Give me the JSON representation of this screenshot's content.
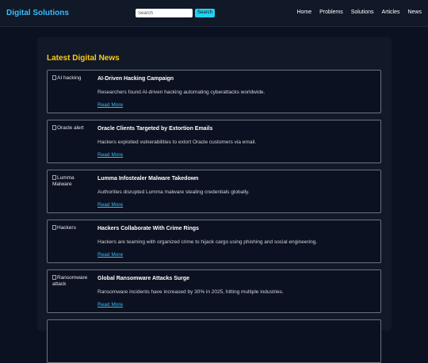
{
  "header": {
    "brand": "Digital Solutions",
    "search_placeholder": "Search",
    "search_button": "Search",
    "nav": [
      "Home",
      "Problems",
      "Solutions",
      "Articles",
      "News"
    ]
  },
  "main": {
    "title": "Latest Digital News",
    "articles": [
      {
        "img_alt": "AI hacking",
        "title": "AI-Driven Hacking Campaign",
        "summary": "Researchers found AI-driven hacking automating cyberattacks worldwide.",
        "link": "Read More"
      },
      {
        "img_alt": "Oracle alert",
        "title": "Oracle Clients Targeted by Extortion Emails",
        "summary": "Hackers exploited vulnerabilities to extort Oracle customers via email.",
        "link": "Read More"
      },
      {
        "img_alt": "Lumma Malware",
        "title": "Lumma Infostealer Malware Takedown",
        "summary": "Authorities disrupted Lumma malware stealing credentials globally.",
        "link": "Read More"
      },
      {
        "img_alt": "Hackers",
        "title": "Hackers Collaborate With Crime Rings",
        "summary": "Hackers are teaming with organized crime to hijack cargo using phishing and social engineering.",
        "link": "Read More"
      },
      {
        "img_alt": "Ransomware attack",
        "title": "Global Ransomware Attacks Surge",
        "summary": "Ransomware incidents have increased by 30% in 2025, hitting multiple industries.",
        "link": "Read More"
      }
    ]
  },
  "colors": {
    "accent": "#38bdf8",
    "title": "#facc15",
    "background": "#0b1120"
  }
}
